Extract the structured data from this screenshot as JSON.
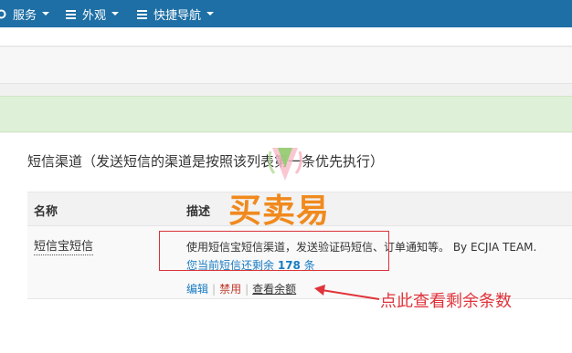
{
  "topnav": {
    "menus": [
      {
        "label": "服务",
        "icon": "gear-icon"
      },
      {
        "label": "外观",
        "icon": "list-icon"
      },
      {
        "label": "快捷导航",
        "icon": "list-icon"
      }
    ]
  },
  "panel": {
    "title": "短信渠道（发送短信的渠道是按照该列表第一条优先执行）",
    "columns": [
      "名称",
      "描述"
    ],
    "rows": [
      {
        "name": "短信宝短信",
        "description": "使用短信宝短信渠道，发送验证码短信、订单通知等。 By ECJIA TEAM.",
        "balance_prefix": "您当前短信还剩余",
        "balance_count": "178",
        "balance_suffix": "条",
        "actions": {
          "edit": "编辑",
          "disable": "禁用",
          "check_balance": "查看余额"
        }
      }
    ]
  },
  "watermark": {
    "text": "买卖易"
  },
  "annotation": {
    "text": "点此查看剩余条数"
  },
  "colors": {
    "nav": "#1d6fa5",
    "alert": "#dff0d8",
    "highlight": "#d9343a",
    "link": "#1a7cc3",
    "watermark": "#f08a1e"
  }
}
